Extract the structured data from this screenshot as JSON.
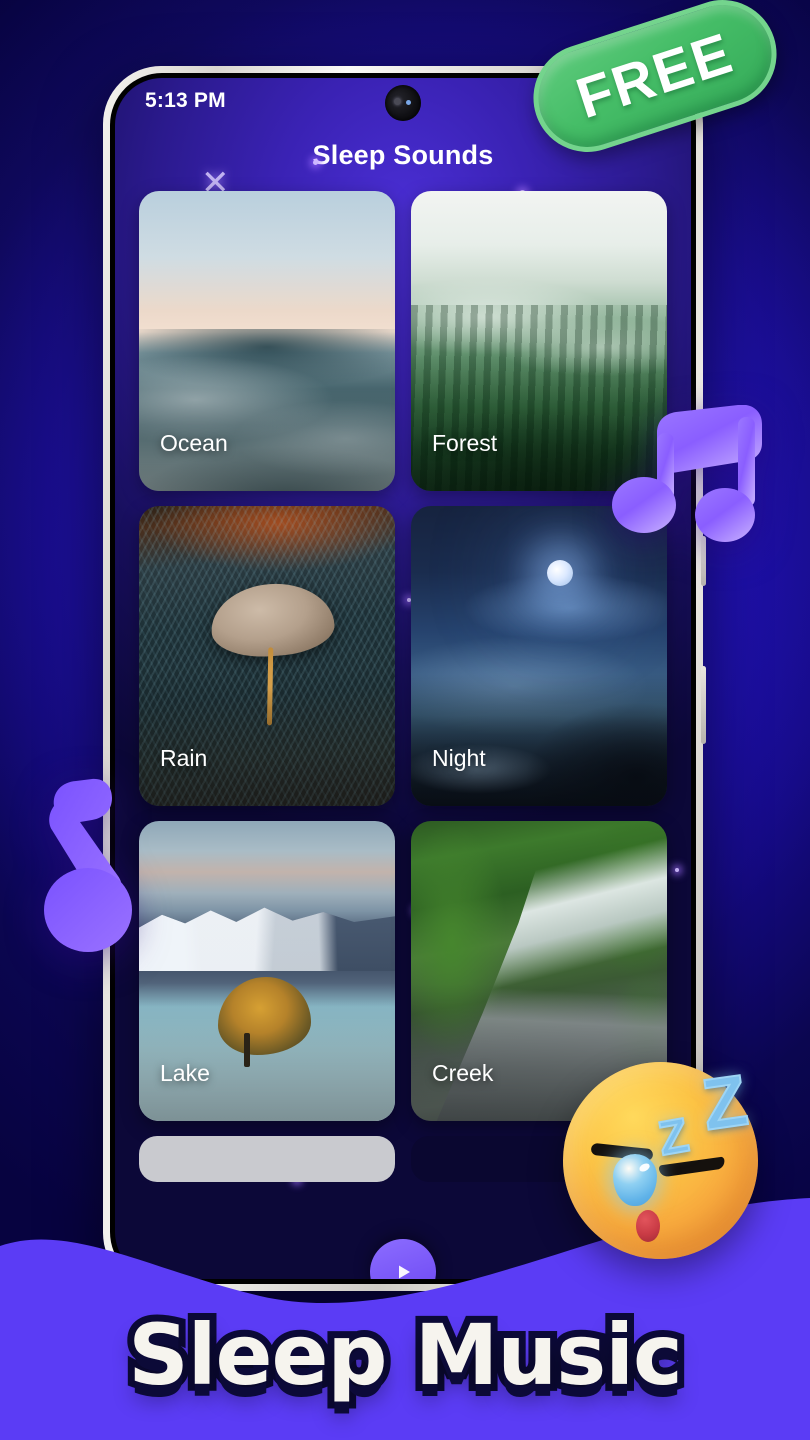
{
  "promo": {
    "badge_label": "FREE",
    "badge_color": "#45bd67",
    "bottom_title": "Sleep Music",
    "background_color": "#070340",
    "wave_color": "#5b3cf5",
    "decor": {
      "music_note_double": "music-note-double",
      "music_note_single": "music-note-single",
      "sleepy_emoji": "sleepy-face-emoji",
      "emoji_z_big": "Z",
      "emoji_z_small": "Z"
    }
  },
  "phone": {
    "status_bar": {
      "time": "5:13 PM",
      "icons": [
        "alarm-icon",
        "bluetooth-icon",
        "wifi-icon"
      ]
    },
    "app": {
      "title": "Sleep Sounds",
      "cards": [
        {
          "label": "Ocean",
          "art": "ocean"
        },
        {
          "label": "Forest",
          "art": "forest"
        },
        {
          "label": "Rain",
          "art": "rain"
        },
        {
          "label": "Night",
          "art": "night"
        },
        {
          "label": "Lake",
          "art": "lake"
        },
        {
          "label": "Creek",
          "art": "creek"
        }
      ],
      "play_button": "play-icon"
    }
  }
}
